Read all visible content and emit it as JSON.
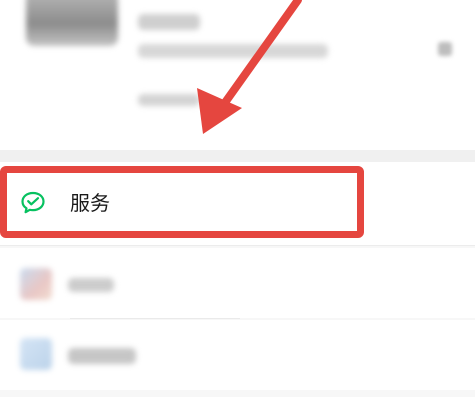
{
  "service_row": {
    "label": "服务",
    "icon": "wechat-pay-icon",
    "icon_color": "#07c160"
  },
  "annotation": {
    "color": "#e5463f"
  }
}
